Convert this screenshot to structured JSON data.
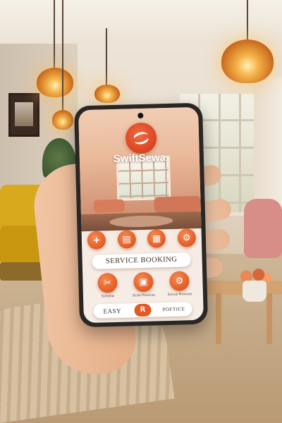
{
  "app": {
    "name": "SwiftSewa"
  },
  "quick_icons": [
    {
      "icon": "plus-icon",
      "glyph": "+"
    },
    {
      "icon": "calendar-icon",
      "glyph": "▤"
    },
    {
      "icon": "grid-icon",
      "glyph": "▦"
    },
    {
      "icon": "settings-icon",
      "glyph": "⚙"
    }
  ],
  "service_booking_label": "SERVICE BOOKING",
  "features": [
    {
      "icon": "wrench-icon",
      "glyph": "✂",
      "label": "Schesiw"
    },
    {
      "icon": "service-icon",
      "glyph": "▣",
      "label": "Scsio Provices"
    },
    {
      "icon": "provider-icon",
      "glyph": "⚙",
      "label": "Scivce Provices"
    }
  ],
  "bottom_bar": {
    "left_label": "EASY",
    "center_glyph": "R",
    "right_label": "POFTICE"
  },
  "colors": {
    "accent": "#e45a24",
    "brand_text": "#ffffff"
  }
}
